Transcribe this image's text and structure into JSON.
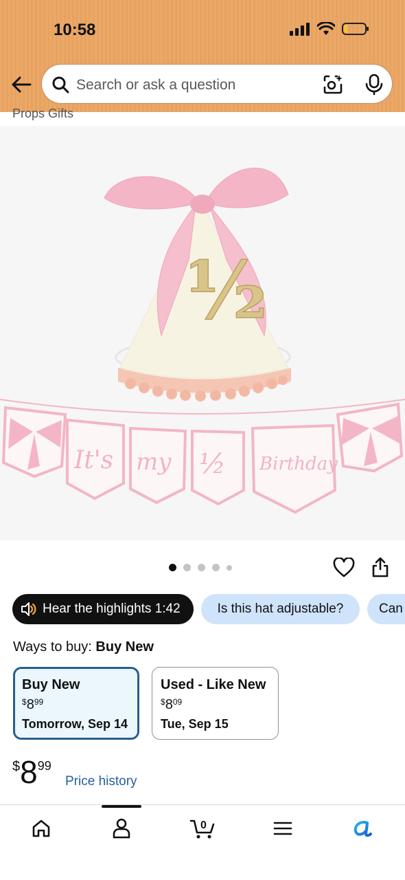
{
  "status": {
    "time": "10:58"
  },
  "search": {
    "placeholder": "Search or ask a question"
  },
  "product": {
    "brand_partial": "Props Gifts",
    "image_text": {
      "numeral": "½",
      "banner": [
        "It's",
        "my",
        "½",
        "Birthday"
      ]
    },
    "carousel": {
      "total_dots": 5,
      "active_index": 0
    }
  },
  "chips": [
    {
      "label": "Hear the highlights 1:42",
      "icon": "speaker-icon"
    },
    {
      "label": "Is this hat adjustable?"
    },
    {
      "label": "Can"
    }
  ],
  "ways_to_buy": {
    "prefix": "Ways to buy:",
    "selected": "Buy New",
    "options": [
      {
        "title": "Buy New",
        "price_symbol": "$",
        "price_whole": "8",
        "price_fraction": "99",
        "delivery": "Tomorrow, Sep 14",
        "selected": true
      },
      {
        "title": "Used - Like New",
        "price_symbol": "$",
        "price_whole": "8",
        "price_fraction": "09",
        "delivery": "Tue, Sep 15",
        "selected": false
      }
    ]
  },
  "price": {
    "symbol": "$",
    "whole": "8",
    "fraction": "99",
    "history_link": "Price history"
  },
  "bottom_nav": {
    "items": [
      "home-icon",
      "account-icon",
      "cart-icon",
      "menu-icon",
      "rufus-icon"
    ],
    "cart_count": "0"
  },
  "colors": {
    "header": "#eaa968",
    "selected_border": "#2a5d8f",
    "chip_blue": "#cfe3fb",
    "link": "#2162a1",
    "pink": "#f4b6c6"
  }
}
